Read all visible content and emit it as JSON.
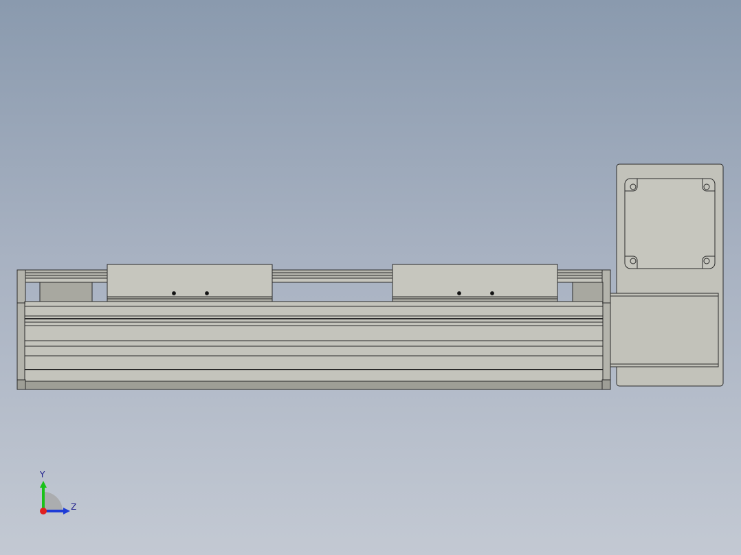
{
  "viewport": {
    "background_top": "#8a9aae",
    "background_bottom": "#c3c9d3",
    "part_fill": "#c0c0b8",
    "part_shadow": "#9b9b94",
    "edge_color": "#2a2a2a"
  },
  "triad": {
    "y_label": "Y",
    "z_label": "Z",
    "y_color": "#19c219",
    "z_color": "#1e3cd6",
    "x_color": "#e02020"
  }
}
